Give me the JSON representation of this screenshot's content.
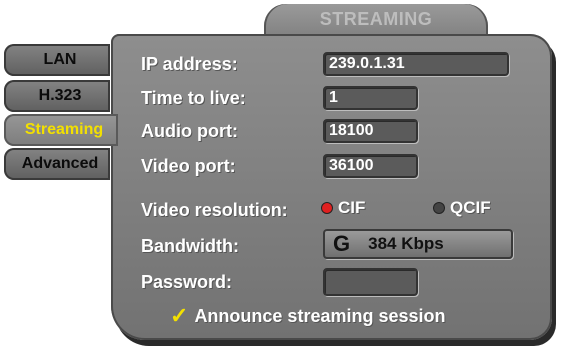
{
  "header": {
    "title": "STREAMING"
  },
  "tabs": [
    {
      "label": "LAN",
      "active": false
    },
    {
      "label": "H.323",
      "active": false
    },
    {
      "label": "Streaming",
      "active": true
    },
    {
      "label": "Advanced",
      "active": false
    }
  ],
  "form": {
    "ip_label": "IP address:",
    "ip_value": "239.0.1.31",
    "ttl_label": "Time to live:",
    "ttl_value": "1",
    "audio_label": "Audio port:",
    "audio_value": "18100",
    "video_label": "Video port:",
    "video_value": "36100",
    "resolution_label": "Video resolution:",
    "resolution_options": [
      {
        "label": "CIF",
        "selected": true
      },
      {
        "label": "QCIF",
        "selected": false
      }
    ],
    "bandwidth_label": "Bandwidth:",
    "bandwidth_value": "384 Kbps",
    "password_label": "Password:",
    "password_value": "",
    "announce_label": "Announce streaming session",
    "announce_checked": true
  },
  "colors": {
    "active_tab_text": "#f3e000",
    "selected_radio": "#e02020",
    "unselected_radio": "#444444",
    "checkmark": "#f3e000"
  },
  "icons": {
    "bandwidth": "swirl-icon",
    "announce": "checkmark-icon"
  }
}
